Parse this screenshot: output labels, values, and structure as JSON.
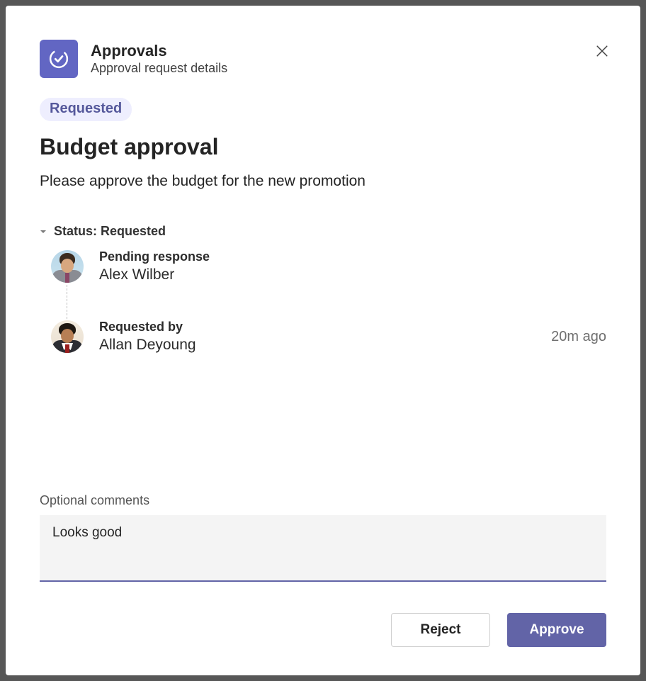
{
  "header": {
    "app_title": "Approvals",
    "subtitle": "Approval request details"
  },
  "status_badge": "Requested",
  "request": {
    "title": "Budget approval",
    "description": "Please approve the budget for the new promotion"
  },
  "status_section": {
    "label": "Status: Requested",
    "pending_label": "Pending response",
    "pending_name": "Alex Wilber",
    "requested_label": "Requested by",
    "requested_name": "Allan Deyoung",
    "timestamp": "20m ago"
  },
  "comments": {
    "label": "Optional comments",
    "value": "Looks good"
  },
  "actions": {
    "reject": "Reject",
    "approve": "Approve"
  }
}
